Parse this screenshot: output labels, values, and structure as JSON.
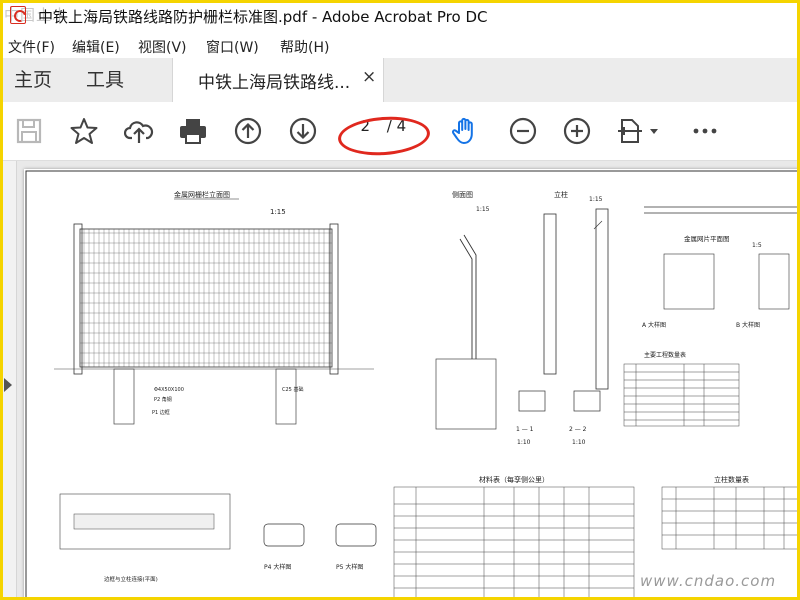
{
  "window": {
    "title": "中铁上海局铁路线路防护栅栏标准图.pdf - Adobe Acrobat Pro DC",
    "watermark": "中国土木"
  },
  "menu": [
    "文件(F)",
    "编辑(E)",
    "视图(V)",
    "窗口(W)",
    "帮助(H)"
  ],
  "tabs": {
    "home": "主页",
    "tools": "工具",
    "document": "中铁上海局铁路线...",
    "close": "×"
  },
  "toolbar": {
    "icons": [
      "save-icon",
      "star-icon",
      "cloud-upload-icon",
      "print-icon",
      "page-up-icon",
      "page-down-icon",
      "hand-icon",
      "zoom-out-icon",
      "zoom-in-icon",
      "fit-page-icon",
      "more-icon"
    ],
    "page_current": "2",
    "page_total": "/ 4",
    "accent": "#1473e6",
    "annotation_color": "#e0281e"
  },
  "drawing": {
    "main_title": "金属网栅栏立面图",
    "scale_main": "1:15",
    "side_title": "侧面图",
    "side_scale": "1:15",
    "post_title": "立柱",
    "post_scale": "1:15",
    "net_plan_title": "金属网片平面图",
    "net_plan_scale": "1:5",
    "detail_a": "A 大样图",
    "detail_b": "B 大样图",
    "table_title": "材料表（每孪侧公里）",
    "qty_title": "主要工程数量表",
    "post_table_title": "立柱数量表",
    "section_1": "1 — 1",
    "section_2": "2 — 2",
    "scale_1_10a": "1:10",
    "scale_1_10b": "1:10",
    "p4_detail": "P4 大样图",
    "p5_detail": "P5 大样图",
    "bottom_label": "边框与立柱连接(平面)",
    "p2_label": "P2 角钢",
    "p1_label": "P1 边框",
    "c25": "C25 基础",
    "mesh_note": "Φ4X50X100",
    "footer_watermark": "www.cndao.com"
  }
}
